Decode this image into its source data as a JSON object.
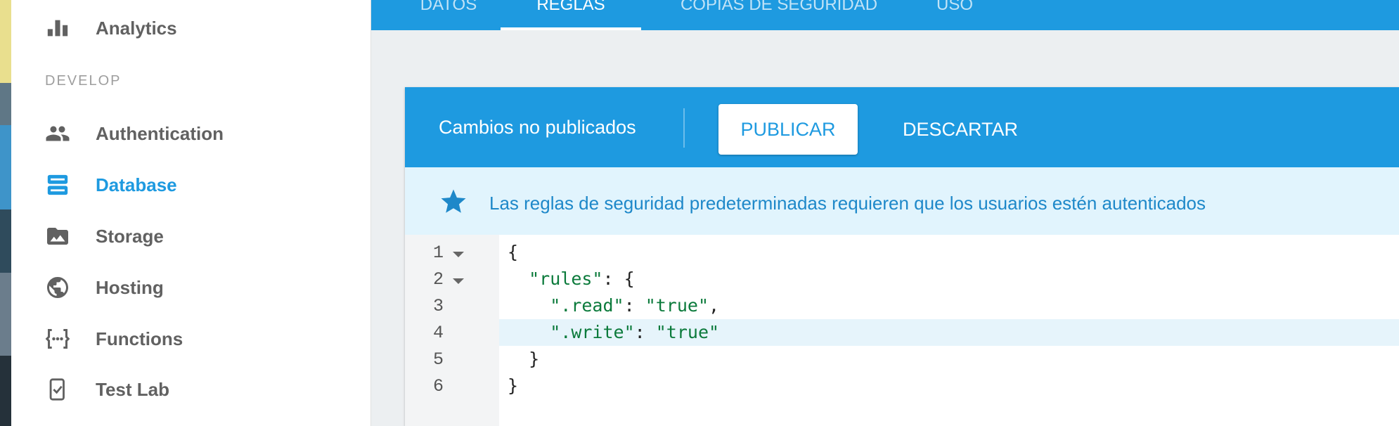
{
  "sidebar": {
    "top_item": {
      "label": "Analytics",
      "icon": "bar-chart-icon"
    },
    "section_label": "DEVELOP",
    "items": [
      {
        "label": "Authentication",
        "icon": "people-icon"
      },
      {
        "label": "Database",
        "icon": "database-icon",
        "active": true
      },
      {
        "label": "Storage",
        "icon": "photo-folder-icon"
      },
      {
        "label": "Hosting",
        "icon": "globe-icon"
      },
      {
        "label": "Functions",
        "icon": "functions-icon"
      },
      {
        "label": "Test Lab",
        "icon": "test-lab-icon"
      }
    ]
  },
  "tabs": [
    {
      "label": "DATOS"
    },
    {
      "label": "REGLAS",
      "active": true
    },
    {
      "label": "COPIAS DE SEGURIDAD"
    },
    {
      "label": "USO"
    }
  ],
  "toolbar": {
    "status": "Cambios no publicados",
    "publish_label": "PUBLICAR",
    "discard_label": "DESCARTAR"
  },
  "notice": {
    "icon": "star-icon",
    "message": "Las reglas de seguridad predeterminadas requieren que los usuarios estén autenticados"
  },
  "editor": {
    "line_numbers": [
      "1",
      "2",
      "3",
      "4",
      "5",
      "6"
    ],
    "lines": [
      "{",
      "  \"rules\": {",
      "    \".read\": \"true\",",
      "    \".write\": \"true\"",
      "  }",
      "}"
    ],
    "highlighted_line": 4
  },
  "colors": {
    "accent": "#1e9ae0",
    "notice_bg": "#e1f4fd",
    "string": "#0b7a3b"
  }
}
